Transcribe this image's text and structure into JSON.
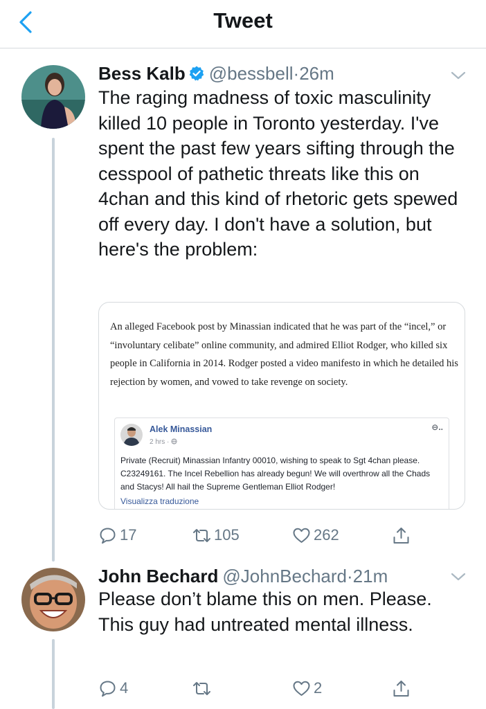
{
  "header": {
    "title": "Tweet",
    "back_icon": "chevron-left-icon"
  },
  "tweets": [
    {
      "display_name": "Bess Kalb",
      "verified": true,
      "handle": "@bessbell",
      "separator": "·",
      "time": "26m",
      "text": "The raging madness of toxic masculinity killed 10 people in Toronto yesterday. I've spent the past few years sifting through the cesspool of pathetic threats like this on 4chan and this kind of rhetoric gets spewed off every day. I don't have a solution, but here's the problem:",
      "media": {
        "article_text": "An alleged Facebook post by Minassian indicated that he was part of the “incel,” or “involuntary celibate” online community, and admired Elliot Rodger, who killed six people in California in 2014. Rodger posted a video manifesto in which he detailed his rejection by women, and vowed to take revenge on society.",
        "fb_post": {
          "name": "Alek Minassian",
          "time": "2 hrs · ",
          "options": "⊖..",
          "text": "Private (Recruit) Minassian Infantry 00010, wishing to speak to Sgt 4chan please. C23249161. The Incel Rebellion has already begun! We will overthrow all the Chads and Stacys! All hail the Supreme Gentleman Elliot Rodger!",
          "translate": "Visualizza traduzione"
        }
      },
      "actions": {
        "replies": "17",
        "retweets": "105",
        "likes": "262"
      }
    },
    {
      "display_name": "John Bechard",
      "verified": false,
      "handle": "@JohnBechard",
      "separator": "·",
      "time": "21m",
      "text": "Please don’t blame this on men. Please.  This guy had untreated mental illness.",
      "actions": {
        "replies": "4",
        "retweets": "",
        "likes": "2"
      }
    }
  ],
  "colors": {
    "accent": "#1da1f2",
    "muted": "#657786",
    "border": "#d6dadd",
    "fb_link": "#365899"
  }
}
